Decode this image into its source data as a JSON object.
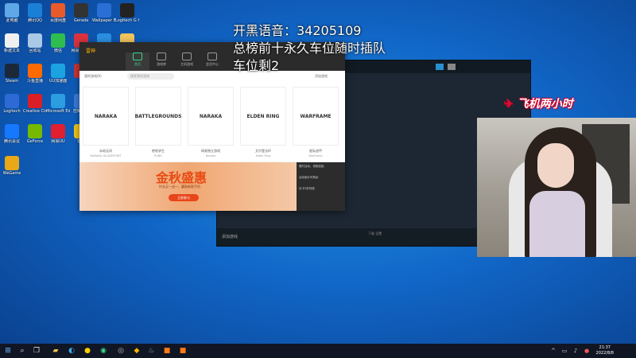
{
  "desktop": {
    "icons": [
      {
        "label": "此电脑",
        "color": "#5fa7e6"
      },
      {
        "label": "腾讯QQ",
        "color": "#1b7fd6"
      },
      {
        "label": "百度网盘",
        "color": "#e85a2a"
      },
      {
        "label": "Gerada",
        "color": "#333333"
      },
      {
        "label": "Wallpaper Engine",
        "color": "#2a6fd6"
      },
      {
        "label": "Logitech G HUB",
        "color": "#222222"
      },
      {
        "label": "新建文本",
        "color": "#f0f0f0"
      },
      {
        "label": "回收站",
        "color": "#a9c9e6"
      },
      {
        "label": "微信",
        "color": "#2ebd4e"
      },
      {
        "label": "网易云音乐",
        "color": "#d9333f"
      },
      {
        "label": "百度网盘",
        "color": "#2a8fe0"
      },
      {
        "label": "新建文件夹",
        "color": "#f1c45c"
      },
      {
        "label": "Steam",
        "color": "#1b2838"
      },
      {
        "label": "斗鱼直播",
        "color": "#ff6a00"
      },
      {
        "label": "UU加速器",
        "color": "#1aa3e0"
      },
      {
        "label": "",
        "color": "#cc3333"
      },
      {
        "label": "迅雷",
        "color": "#3a8ce8"
      },
      {
        "label": "QQ音乐",
        "color": "#31c27c"
      },
      {
        "label": "Logitech",
        "color": "#2d6ad6"
      },
      {
        "label": "Creative Cloud",
        "color": "#da1f26"
      },
      {
        "label": "Microsoft Edge",
        "color": "#2b9de0"
      },
      {
        "label": "控制面板",
        "color": "#3c7bd6"
      },
      {
        "label": "OBS Studio",
        "color": "#302e31"
      },
      {
        "label": "Discord",
        "color": "#5865f2"
      },
      {
        "label": "腾讯会议",
        "color": "#1677ff"
      },
      {
        "label": "GeForce",
        "color": "#76b900"
      },
      {
        "label": "网易UU",
        "color": "#e0202f"
      },
      {
        "label": "雷神",
        "color": "#f0c419"
      },
      {
        "label": "WPS Office",
        "color": "#d72b2b"
      },
      {
        "label": "迅游",
        "color": "#2a5ad6"
      },
      {
        "label": "WeGame",
        "color": "#e8a818"
      }
    ]
  },
  "launcher": {
    "logo": "雷神",
    "tabs": [
      {
        "label": "首页"
      },
      {
        "label": "游戏库"
      },
      {
        "label": "主机游戏"
      },
      {
        "label": "会员中心"
      }
    ],
    "window_controls": "— □ ✕",
    "list_label": "我的游戏(6)",
    "search_placeholder": "搜索我的游戏",
    "add_label": "添加游戏",
    "games": [
      {
        "art": "NARAKA",
        "name": "永劫无间",
        "en": "NARAKA: BLADEPOINT"
      },
      {
        "art": "BATTLEGROUNDS",
        "name": "绝地求生",
        "en": "PUBG"
      },
      {
        "art": "NARAKA",
        "name": "网易独立游戏",
        "en": "Naraka"
      },
      {
        "art": "ELDEN RING",
        "name": "艾尔登法环",
        "en": "Elden Ring"
      },
      {
        "art": "WARFRAME",
        "name": "星际战甲",
        "en": "Warframe"
      }
    ],
    "promo": {
      "title": "金秋盛惠",
      "subtitle": "时长买一送一，赢取新款手机",
      "button": "立即参与"
    },
    "side_items": [
      "限时活动，领取奖励",
      "活动倒计时剩余",
      "月卡5折特惠"
    ]
  },
  "dark_window": {
    "footer_left": "添加游戏",
    "footer_center": "下载\n设置"
  },
  "overlay": {
    "line1": "开黑语音：34205109",
    "line2": "总榜前十永久车位随时插队",
    "line3": "车位剩2"
  },
  "badge": {
    "text": "飞机两小时",
    "plane": "✈"
  },
  "taskbar": {
    "time": "21:37",
    "date": "2022/8/8"
  }
}
